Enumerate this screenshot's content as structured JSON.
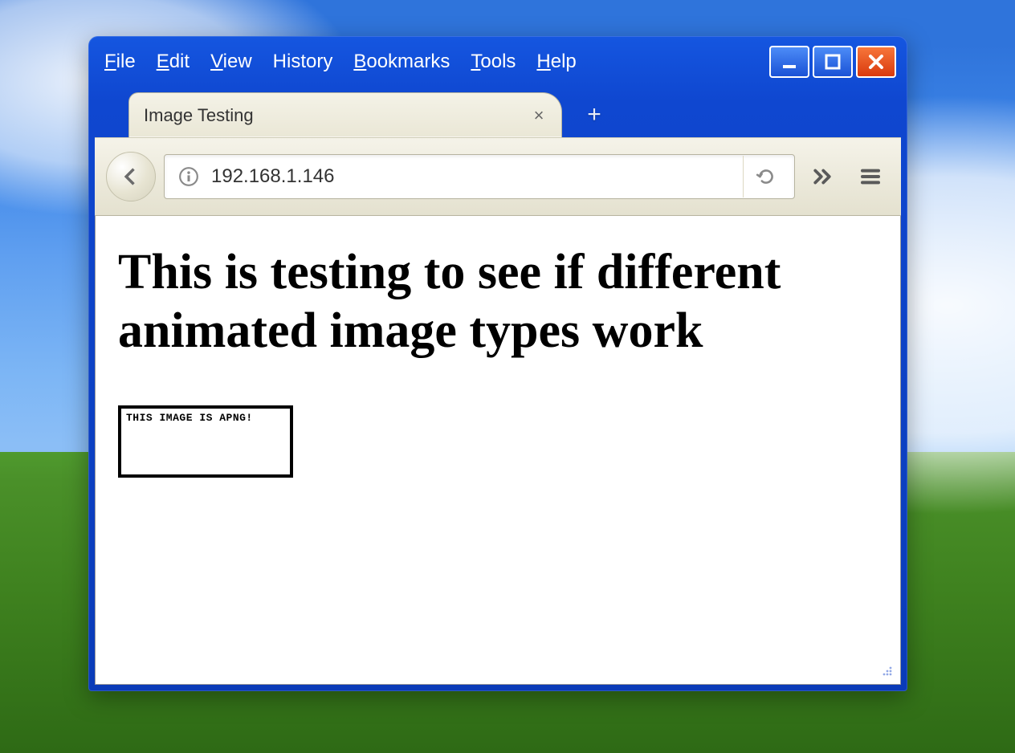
{
  "menu": {
    "file": "File",
    "edit": "Edit",
    "view": "View",
    "history": "History",
    "bookmarks": "Bookmarks",
    "tools": "Tools",
    "help": "Help"
  },
  "tab": {
    "title": "Image Testing"
  },
  "urlbar": {
    "value": "192.168.1.146"
  },
  "page": {
    "heading": "This is testing to see if different animated image types work",
    "image_caption": "THIS IMAGE IS APNG!"
  }
}
